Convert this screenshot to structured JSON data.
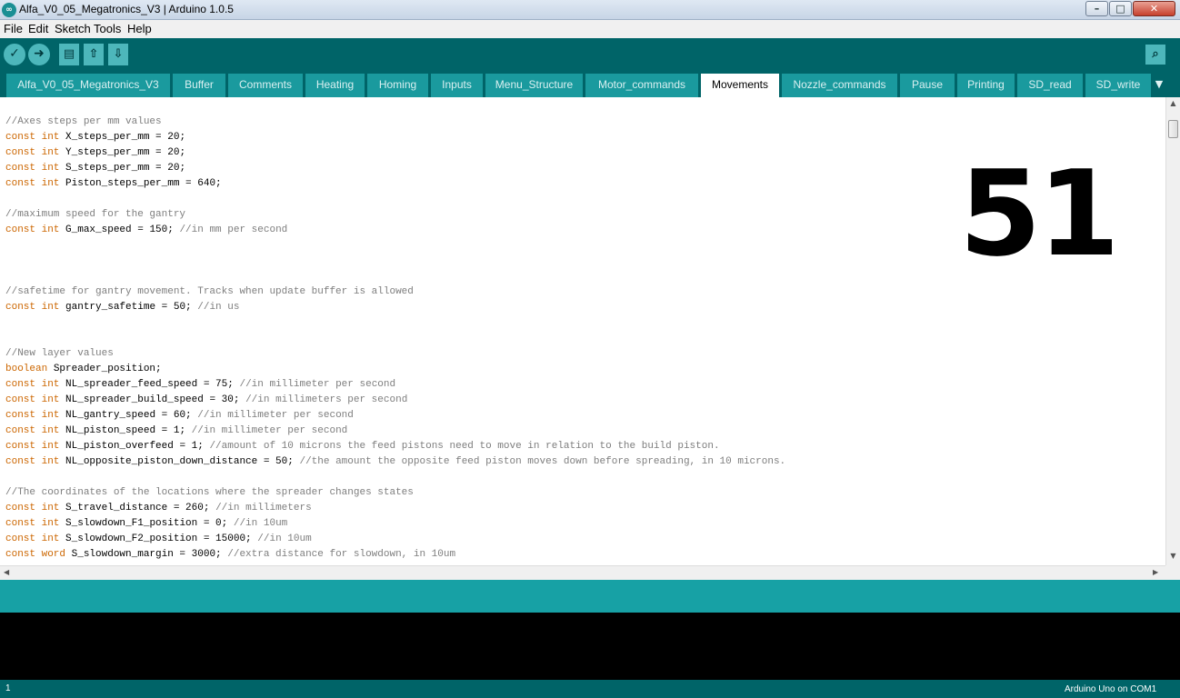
{
  "window": {
    "title": "Alfa_V0_05_Megatronics_V3 | Arduino 1.0.5",
    "controls": {
      "minimize": "–",
      "maximize": "□",
      "close": "✕"
    }
  },
  "menu": [
    "File",
    "Edit",
    "Sketch",
    "Tools",
    "Help"
  ],
  "toolbar": {
    "verify_icon": "checkmark-icon",
    "upload_icon": "arrow-right-icon",
    "new_icon": "new-document-icon",
    "open_icon": "open-up-arrow-icon",
    "save_icon": "save-down-arrow-icon",
    "serial_monitor_icon": "magnifier-icon"
  },
  "tabs": [
    "Alfa_V0_05_Megatronics_V3",
    "Buffer",
    "Comments",
    "Heating",
    "Homing",
    "Inputs",
    "Menu_Structure",
    "Motor_commands",
    "Movements",
    "Nozzle_commands",
    "Pause",
    "Printing",
    "SD_read",
    "SD_write"
  ],
  "active_tab": "Movements",
  "overlay_number": "51",
  "code": [
    [
      [
        "cm",
        "//Axes steps per mm values"
      ]
    ],
    [
      [
        "kw",
        "const int"
      ],
      [
        "tx",
        " X_steps_per_mm = 20;"
      ]
    ],
    [
      [
        "kw",
        "const int"
      ],
      [
        "tx",
        " Y_steps_per_mm = 20;"
      ]
    ],
    [
      [
        "kw",
        "const int"
      ],
      [
        "tx",
        " S_steps_per_mm = 20;"
      ]
    ],
    [
      [
        "kw",
        "const int"
      ],
      [
        "tx",
        " Piston_steps_per_mm = 640;"
      ]
    ],
    [],
    [
      [
        "cm",
        "//maximum speed for the gantry"
      ]
    ],
    [
      [
        "kw",
        "const int"
      ],
      [
        "tx",
        " G_max_speed = 150; "
      ],
      [
        "cm",
        "//in mm per second"
      ]
    ],
    [],
    [],
    [],
    [
      [
        "cm",
        "//safetime for gantry movement. Tracks when update buffer is allowed"
      ]
    ],
    [
      [
        "kw",
        "const int"
      ],
      [
        "tx",
        " gantry_safetime = 50; "
      ],
      [
        "cm",
        "//in us"
      ]
    ],
    [],
    [],
    [
      [
        "cm",
        "//New layer values"
      ]
    ],
    [
      [
        "kw",
        "boolean"
      ],
      [
        "tx",
        " Spreader_position;"
      ]
    ],
    [
      [
        "kw",
        "const int"
      ],
      [
        "tx",
        " NL_spreader_feed_speed = 75; "
      ],
      [
        "cm",
        "//in millimeter per second"
      ]
    ],
    [
      [
        "kw",
        "const int"
      ],
      [
        "tx",
        " NL_spreader_build_speed = 30; "
      ],
      [
        "cm",
        "//in millimeters per second"
      ]
    ],
    [
      [
        "kw",
        "const int"
      ],
      [
        "tx",
        " NL_gantry_speed = 60; "
      ],
      [
        "cm",
        "//in millimeter per second"
      ]
    ],
    [
      [
        "kw",
        "const int"
      ],
      [
        "tx",
        " NL_piston_speed = 1; "
      ],
      [
        "cm",
        "//in millimeter per second"
      ]
    ],
    [
      [
        "kw",
        "const int"
      ],
      [
        "tx",
        " NL_piston_overfeed = 1; "
      ],
      [
        "cm",
        "//amount of 10 microns the feed pistons need to move in relation to the build piston."
      ]
    ],
    [
      [
        "kw",
        "const int"
      ],
      [
        "tx",
        " NL_opposite_piston_down_distance = 50; "
      ],
      [
        "cm",
        "//the amount the opposite feed piston moves down before spreading, in 10 microns."
      ]
    ],
    [],
    [
      [
        "cm",
        "//The coordinates of the locations where the spreader changes states"
      ]
    ],
    [
      [
        "kw",
        "const int"
      ],
      [
        "tx",
        " S_travel_distance = 260; "
      ],
      [
        "cm",
        "//in millimeters"
      ]
    ],
    [
      [
        "kw",
        "const int"
      ],
      [
        "tx",
        " S_slowdown_F1_position = 0; "
      ],
      [
        "cm",
        "//in 10um"
      ]
    ],
    [
      [
        "kw",
        "const int"
      ],
      [
        "tx",
        " S_slowdown_F2_position = 15000; "
      ],
      [
        "cm",
        "//in 10um"
      ]
    ],
    [
      [
        "kw",
        "const word"
      ],
      [
        "tx",
        " S_slowdown_margin = 3000; "
      ],
      [
        "cm",
        "//extra distance for slowdown, in 10um"
      ]
    ]
  ],
  "status": {
    "line_number": "1",
    "board": "Arduino Uno on COM1"
  },
  "colors": {
    "keyword": "#cc6600",
    "comment": "#7e7e7e",
    "toolbar_bg": "#006468",
    "tab_bg": "#1a9a9e",
    "status_bg": "#17a1a5",
    "console_bg": "#000000"
  }
}
